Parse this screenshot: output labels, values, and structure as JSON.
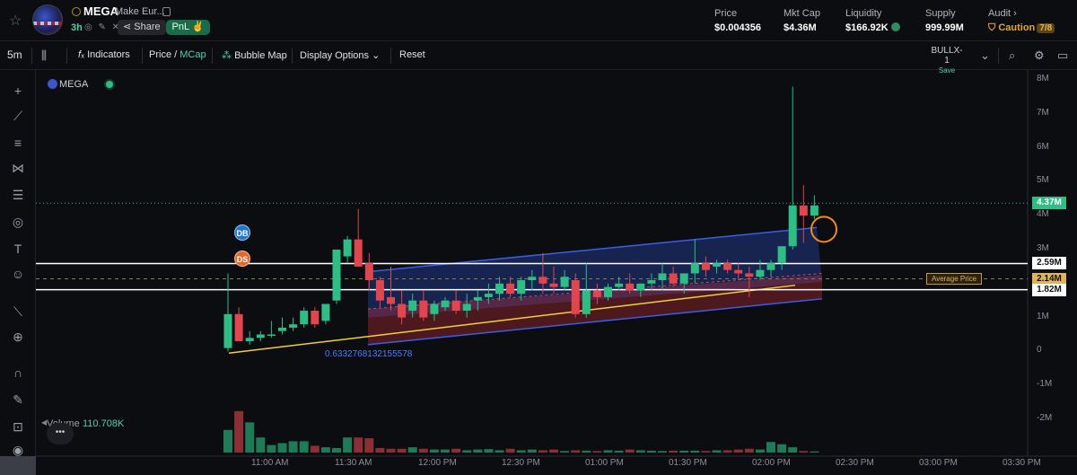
{
  "header": {
    "ticker": "MEGA",
    "name": "Make Eur...",
    "age": "3h",
    "share_label": "Share",
    "pnl_label": "PnL",
    "stats": [
      {
        "label": "Price",
        "value": "$0.004356"
      },
      {
        "label": "Mkt Cap",
        "value": "$4.36M"
      },
      {
        "label": "Liquidity",
        "value": "$166.92K"
      },
      {
        "label": "Supply",
        "value": "999.99M"
      },
      {
        "label": "Audit",
        "value": "Caution",
        "count": "7/8"
      }
    ]
  },
  "toolbar": {
    "interval": "5m",
    "indicators": "Indicators",
    "price_label": "Price /",
    "mcap_label": "MCap",
    "bubble_map": "Bubble Map",
    "display_options": "Display Options",
    "reset": "Reset",
    "template_name": "BULLX-1",
    "template_save": "Save"
  },
  "chart_legend": {
    "ticker": "MEGA",
    "volume_label": "Volume",
    "volume_value": "110.708K",
    "fib_value": "0.6332768132155578",
    "average_price_label": "Average Price",
    "markers": [
      "DB",
      "DS"
    ]
  },
  "chart_data": {
    "type": "candlestick",
    "y_axis_labels": [
      "8M",
      "7M",
      "6M",
      "5M",
      "4M",
      "3M",
      "2M",
      "1M",
      "0",
      "-1M",
      "-2M"
    ],
    "x_axis_labels": [
      "11:00 AM",
      "11:30 AM",
      "12:00 PM",
      "12:30 PM",
      "01:00 PM",
      "01:30 PM",
      "02:00 PM",
      "02:30 PM",
      "03:00 PM",
      "03:30 PM"
    ],
    "ylim": [
      -2000000,
      8000000
    ],
    "price_tags": [
      {
        "label": "4.37M",
        "value": 4370000,
        "color": "#2ebd85"
      },
      {
        "label": "2.59M",
        "value": 2590000,
        "color": "#ffffff"
      },
      {
        "label": "2.14M",
        "value": 2140000,
        "color": "#e0b45a"
      },
      {
        "label": "1.82M",
        "value": 1820000,
        "color": "#ffffff"
      }
    ],
    "volume": [
      60,
      110,
      80,
      40,
      20,
      25,
      30,
      30,
      18,
      14,
      12,
      40,
      40,
      38,
      12,
      10,
      10,
      14,
      10,
      8,
      8,
      10,
      6,
      8,
      9,
      6,
      10,
      6,
      8,
      6,
      8,
      4,
      6,
      5,
      4,
      6,
      5,
      8,
      6,
      5,
      4,
      5,
      5,
      5,
      4,
      6,
      6,
      8,
      10,
      8,
      28,
      22,
      14,
      4,
      3
    ]
  }
}
